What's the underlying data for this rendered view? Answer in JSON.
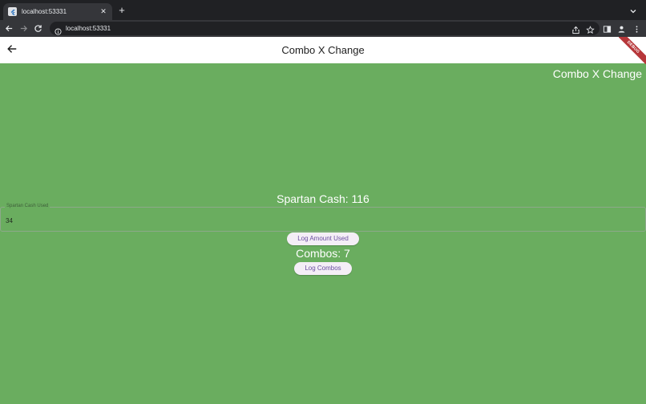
{
  "browser": {
    "tab_title": "localhost:53331",
    "tab_close": "✕",
    "new_tab": "+",
    "url": "localhost:53331"
  },
  "app": {
    "title": "Combo X Change",
    "debug_label": "DEBUG",
    "header_right": "Combo X Change",
    "spartan_cash": "Spartan Cash: 116",
    "field": {
      "label": "Spartan Cash Used",
      "value": "34"
    },
    "log_amount_label": "Log Amount Used",
    "combos": "Combos: 7",
    "log_combos_label": "Log Combos"
  },
  "colors": {
    "background": "#6aad5f",
    "appbar": "#ffffff",
    "button_bg": "#f4eef6",
    "button_text": "#6b4fa0",
    "debug_ribbon": "#b7373a"
  }
}
